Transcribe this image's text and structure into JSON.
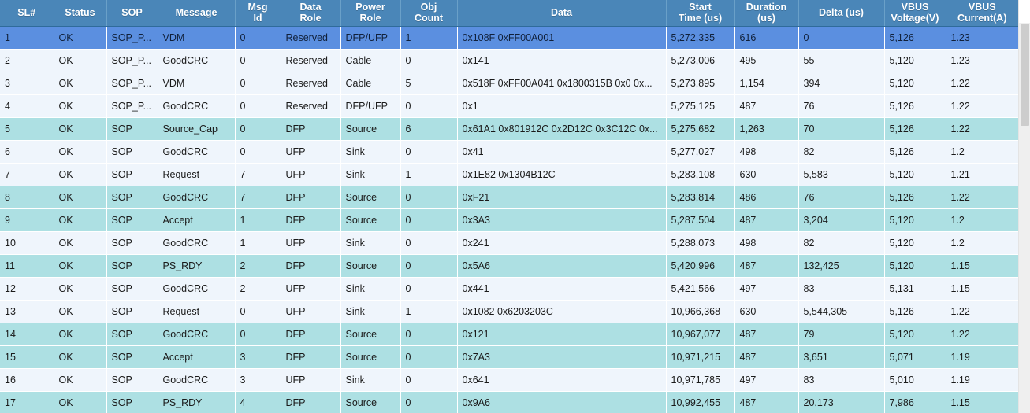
{
  "grid": {
    "columns": [
      {
        "key": "sl",
        "label": "SL#",
        "cls": "c-sl"
      },
      {
        "key": "status",
        "label": "Status",
        "cls": "c-st"
      },
      {
        "key": "sop",
        "label": "SOP",
        "cls": "c-sop"
      },
      {
        "key": "message",
        "label": "Message",
        "cls": "c-msg"
      },
      {
        "key": "msgid",
        "label": "Msg\nId",
        "cls": "c-mid"
      },
      {
        "key": "datarole",
        "label": "Data\nRole",
        "cls": "c-dr"
      },
      {
        "key": "powerrole",
        "label": "Power\nRole",
        "cls": "c-pr"
      },
      {
        "key": "objcount",
        "label": "Obj\nCount",
        "cls": "c-oc"
      },
      {
        "key": "data",
        "label": "Data",
        "cls": "c-data"
      },
      {
        "key": "start",
        "label": "Start\nTime (us)",
        "cls": "c-start"
      },
      {
        "key": "duration",
        "label": "Duration\n(us)",
        "cls": "c-dur"
      },
      {
        "key": "delta",
        "label": "Delta (us)",
        "cls": "c-delta"
      },
      {
        "key": "voltage",
        "label": "VBUS\nVoltage(V)",
        "cls": "c-volt"
      },
      {
        "key": "current",
        "label": "VBUS\nCurrent(A)",
        "cls": "c-curr"
      }
    ],
    "rows": [
      {
        "state": "selected",
        "cells": [
          "1",
          "OK",
          "SOP_P...",
          "VDM",
          "0",
          "Reserved",
          "DFP/UFP",
          "1",
          "0x108F 0xFF00A001",
          "5,272,335",
          "616",
          "0",
          "5,126",
          "1.23"
        ]
      },
      {
        "state": "normal",
        "cells": [
          "2",
          "OK",
          "SOP_P...",
          "GoodCRC",
          "0",
          "Reserved",
          "Cable",
          "0",
          "0x141",
          "5,273,006",
          "495",
          "55",
          "5,120",
          "1.23"
        ]
      },
      {
        "state": "normal",
        "cells": [
          "3",
          "OK",
          "SOP_P...",
          "VDM",
          "0",
          "Reserved",
          "Cable",
          "5",
          "0x518F 0xFF00A041 0x1800315B 0x0 0x...",
          "5,273,895",
          "1,154",
          "394",
          "5,120",
          "1.22"
        ]
      },
      {
        "state": "normal",
        "cells": [
          "4",
          "OK",
          "SOP_P...",
          "GoodCRC",
          "0",
          "Reserved",
          "DFP/UFP",
          "0",
          "0x1",
          "5,275,125",
          "487",
          "76",
          "5,126",
          "1.22"
        ]
      },
      {
        "state": "alt",
        "cells": [
          "5",
          "OK",
          "SOP",
          "Source_Cap",
          "0",
          "DFP",
          "Source",
          "6",
          "0x61A1 0x801912C 0x2D12C 0x3C12C 0x...",
          "5,275,682",
          "1,263",
          "70",
          "5,126",
          "1.22"
        ]
      },
      {
        "state": "normal",
        "cells": [
          "6",
          "OK",
          "SOP",
          "GoodCRC",
          "0",
          "UFP",
          "Sink",
          "0",
          "0x41",
          "5,277,027",
          "498",
          "82",
          "5,126",
          "1.2"
        ]
      },
      {
        "state": "normal",
        "cells": [
          "7",
          "OK",
          "SOP",
          "Request",
          "7",
          "UFP",
          "Sink",
          "1",
          "0x1E82 0x1304B12C",
          "5,283,108",
          "630",
          "5,583",
          "5,120",
          "1.21"
        ]
      },
      {
        "state": "alt",
        "cells": [
          "8",
          "OK",
          "SOP",
          "GoodCRC",
          "7",
          "DFP",
          "Source",
          "0",
          "0xF21",
          "5,283,814",
          "486",
          "76",
          "5,126",
          "1.22"
        ]
      },
      {
        "state": "alt",
        "cells": [
          "9",
          "OK",
          "SOP",
          "Accept",
          "1",
          "DFP",
          "Source",
          "0",
          "0x3A3",
          "5,287,504",
          "487",
          "3,204",
          "5,120",
          "1.2"
        ]
      },
      {
        "state": "normal",
        "cells": [
          "10",
          "OK",
          "SOP",
          "GoodCRC",
          "1",
          "UFP",
          "Sink",
          "0",
          "0x241",
          "5,288,073",
          "498",
          "82",
          "5,120",
          "1.2"
        ]
      },
      {
        "state": "alt",
        "cells": [
          "11",
          "OK",
          "SOP",
          "PS_RDY",
          "2",
          "DFP",
          "Source",
          "0",
          "0x5A6",
          "5,420,996",
          "487",
          "132,425",
          "5,120",
          "1.15"
        ]
      },
      {
        "state": "normal",
        "cells": [
          "12",
          "OK",
          "SOP",
          "GoodCRC",
          "2",
          "UFP",
          "Sink",
          "0",
          "0x441",
          "5,421,566",
          "497",
          "83",
          "5,131",
          "1.15"
        ]
      },
      {
        "state": "normal",
        "cells": [
          "13",
          "OK",
          "SOP",
          "Request",
          "0",
          "UFP",
          "Sink",
          "1",
          "0x1082 0x6203203C",
          "10,966,368",
          "630",
          "5,544,305",
          "5,126",
          "1.22"
        ]
      },
      {
        "state": "alt",
        "cells": [
          "14",
          "OK",
          "SOP",
          "GoodCRC",
          "0",
          "DFP",
          "Source",
          "0",
          "0x121",
          "10,967,077",
          "487",
          "79",
          "5,120",
          "1.22"
        ]
      },
      {
        "state": "alt",
        "cells": [
          "15",
          "OK",
          "SOP",
          "Accept",
          "3",
          "DFP",
          "Source",
          "0",
          "0x7A3",
          "10,971,215",
          "487",
          "3,651",
          "5,071",
          "1.19"
        ]
      },
      {
        "state": "normal",
        "cells": [
          "16",
          "OK",
          "SOP",
          "GoodCRC",
          "3",
          "UFP",
          "Sink",
          "0",
          "0x641",
          "10,971,785",
          "497",
          "83",
          "5,010",
          "1.19"
        ]
      },
      {
        "state": "alt",
        "cells": [
          "17",
          "OK",
          "SOP",
          "PS_RDY",
          "4",
          "DFP",
          "Source",
          "0",
          "0x9A6",
          "10,992,455",
          "487",
          "20,173",
          "7,986",
          "1.15"
        ]
      }
    ]
  },
  "colors": {
    "header_bg": "#4a86b8",
    "row_normal_bg": "#eff5fc",
    "row_alt_bg": "#ade0e3",
    "row_selected_bg": "#5b8fe0",
    "scrollbar_track": "#efefef",
    "scrollbar_thumb": "#cdcdcd"
  }
}
